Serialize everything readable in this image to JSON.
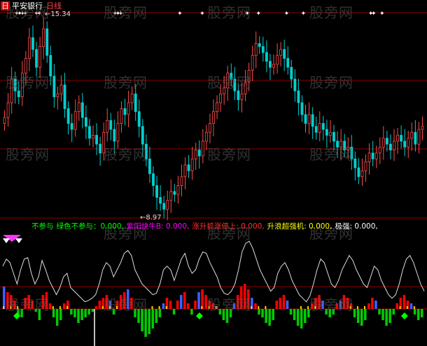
{
  "header": {
    "badge": "日",
    "stock_name": "平安银行",
    "period": "日线"
  },
  "price_annotations": {
    "high_label": "15.34",
    "low_label": "8.97"
  },
  "indicator_legend": [
    {
      "text": "不参与",
      "color": "#00ff00"
    },
    {
      "text": "绿色不参与：0.000,",
      "color": "#00ff00"
    },
    {
      "text": "紫阳快牛B: 0.000,",
      "color": "#ff00ff"
    },
    {
      "text": "涨升抓涨停上: 0.000,",
      "color": "#ff3030"
    },
    {
      "text": "升浪超强机: 0.000,",
      "color": "#ffff00"
    },
    {
      "text": "极强: 0.000,",
      "color": "#ffffff"
    }
  ],
  "watermark": "股旁网",
  "colors": {
    "up": "#ff4d4d",
    "down": "#00d0d0",
    "grid": "#8b0000",
    "line": "#dddddd",
    "hist_pos": "#ff0000",
    "hist_neg": "#00cc00"
  },
  "chart_data": {
    "type": "candlestick",
    "price_high": 15.34,
    "price_low": 8.97,
    "closes": [
      12.1,
      12.6,
      13.4,
      13.0,
      12.8,
      13.6,
      14.1,
      14.8,
      14.4,
      13.8,
      14.5,
      15.1,
      14.2,
      13.5,
      12.8,
      12.9,
      13.2,
      12.4,
      11.9,
      11.7,
      12.3,
      12.6,
      12.1,
      11.8,
      11.4,
      11.5,
      11.2,
      10.9,
      11.6,
      12.0,
      11.7,
      11.3,
      11.9,
      12.4,
      12.2,
      12.6,
      12.9,
      12.3,
      11.8,
      11.2,
      10.7,
      10.2,
      9.8,
      9.4,
      9.2,
      9.0,
      9.3,
      9.6,
      9.5,
      9.8,
      10.1,
      10.5,
      10.3,
      10.7,
      11.0,
      10.8,
      11.3,
      11.6,
      11.9,
      12.3,
      12.6,
      12.9,
      13.1,
      13.6,
      13.4,
      13.0,
      12.7,
      12.9,
      13.3,
      13.7,
      14.2,
      14.6,
      14.5,
      14.3,
      14.0,
      13.8,
      13.9,
      14.2,
      14.4,
      14.1,
      13.8,
      13.4,
      13.0,
      12.6,
      12.2,
      11.9,
      12.2,
      11.8,
      11.6,
      11.9,
      11.7,
      11.5,
      11.6,
      11.3,
      11.1,
      11.3,
      11.0,
      11.1,
      10.7,
      10.4,
      10.1,
      10.3,
      10.6,
      10.9,
      10.7,
      10.9,
      11.1,
      11.4,
      11.2,
      11.0,
      11.3,
      11.5,
      11.3,
      11.1,
      11.4,
      11.6,
      11.2,
      11.7,
      11.8
    ],
    "indicator_line": [
      0.6,
      0.7,
      0.65,
      0.5,
      0.35,
      0.55,
      0.7,
      0.72,
      0.5,
      0.35,
      0.45,
      0.68,
      0.55,
      0.4,
      0.3,
      0.2,
      0.3,
      0.45,
      0.5,
      0.3,
      0.25,
      0.2,
      0.15,
      0.1,
      0.12,
      0.15,
      0.2,
      0.35,
      0.55,
      0.65,
      0.6,
      0.45,
      0.55,
      0.65,
      0.78,
      0.82,
      0.75,
      0.55,
      0.45,
      0.35,
      0.3,
      0.25,
      0.2,
      0.22,
      0.35,
      0.55,
      0.6,
      0.55,
      0.4,
      0.55,
      0.7,
      0.78,
      0.6,
      0.5,
      0.55,
      0.7,
      0.8,
      0.78,
      0.65,
      0.55,
      0.45,
      0.3,
      0.22,
      0.2,
      0.25,
      0.35,
      0.55,
      0.8,
      0.92,
      0.95,
      0.85,
      0.7,
      0.55,
      0.45,
      0.35,
      0.25,
      0.3,
      0.5,
      0.6,
      0.65,
      0.55,
      0.4,
      0.3,
      0.2,
      0.15,
      0.1,
      0.18,
      0.35,
      0.55,
      0.7,
      0.65,
      0.5,
      0.35,
      0.3,
      0.4,
      0.55,
      0.65,
      0.75,
      0.68,
      0.55,
      0.45,
      0.35,
      0.3,
      0.45,
      0.6,
      0.55,
      0.4,
      0.3,
      0.2,
      0.15,
      0.2,
      0.35,
      0.55,
      0.7,
      0.75,
      0.65,
      0.5,
      0.35,
      0.25
    ],
    "histogram": [
      0.8,
      0.6,
      0.5,
      0.3,
      -0.2,
      -0.3,
      0.4,
      0.5,
      0.3,
      -0.1,
      -0.4,
      0.5,
      0.6,
      0.2,
      -0.3,
      -0.6,
      -0.4,
      0.2,
      0.3,
      -0.2,
      -0.3,
      -0.5,
      -0.4,
      -0.3,
      -0.2,
      -0.1,
      0.1,
      0.3,
      0.4,
      0.5,
      0.3,
      -0.2,
      0.3,
      0.5,
      0.6,
      0.7,
      0.4,
      -0.3,
      -0.5,
      -0.8,
      -1.0,
      -0.9,
      -0.7,
      -0.5,
      -0.3,
      0.2,
      0.4,
      0.3,
      -0.2,
      0.3,
      0.5,
      0.6,
      0.2,
      -0.2,
      0.3,
      0.6,
      0.7,
      0.5,
      0.3,
      0.2,
      0.1,
      -0.2,
      -0.4,
      -0.5,
      -0.3,
      0.2,
      0.5,
      0.8,
      0.9,
      0.7,
      0.4,
      0.2,
      -0.2,
      -0.3,
      -0.5,
      -0.6,
      -0.4,
      0.3,
      0.4,
      0.5,
      0.3,
      -0.2,
      -0.4,
      -0.6,
      -0.7,
      -0.5,
      -0.3,
      0.2,
      0.4,
      0.5,
      0.3,
      -0.2,
      -0.3,
      -0.2,
      0.2,
      0.3,
      0.5,
      0.4,
      0.2,
      -0.3,
      -0.5,
      -0.6,
      -0.4,
      0.2,
      0.4,
      0.3,
      -0.2,
      -0.4,
      -0.6,
      -0.5,
      -0.2,
      0.2,
      0.4,
      0.5,
      0.3,
      0.2,
      -0.2,
      -0.4,
      -0.3
    ],
    "top_markers": [
      5,
      6,
      7,
      8,
      12,
      13,
      40,
      41,
      42,
      63,
      71,
      87,
      91,
      101,
      107,
      131,
      132,
      135
    ],
    "bottom_markers": [
      5,
      70,
      143
    ]
  }
}
